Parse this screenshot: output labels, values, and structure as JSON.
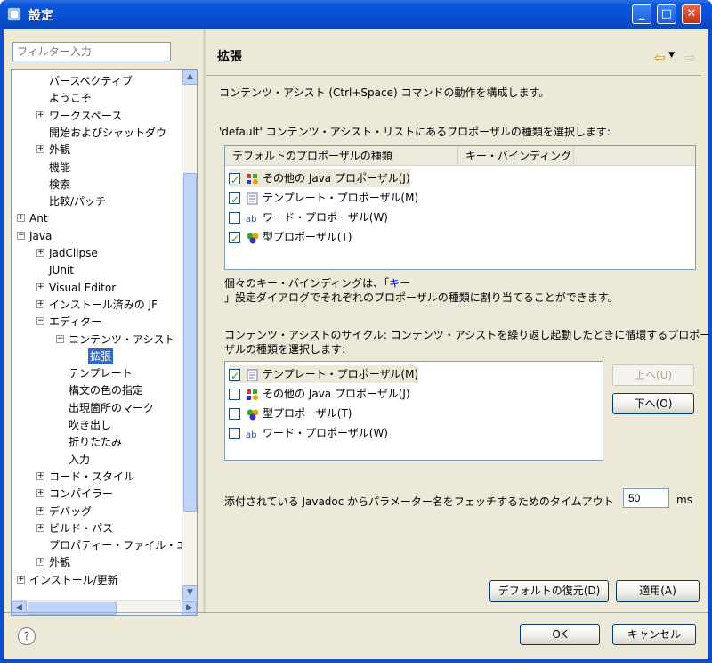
{
  "window": {
    "title": "設定"
  },
  "filter": {
    "placeholder": "フィルター入力"
  },
  "tree": [
    {
      "label": "パースペクティブ",
      "level": 2,
      "expander": ""
    },
    {
      "label": "ようこそ",
      "level": 2,
      "expander": ""
    },
    {
      "label": "ワークスペース",
      "level": 2,
      "expander": "+"
    },
    {
      "label": "開始およびシャットダウ",
      "level": 2,
      "expander": ""
    },
    {
      "label": "外観",
      "level": 2,
      "expander": "+"
    },
    {
      "label": "機能",
      "level": 2,
      "expander": ""
    },
    {
      "label": "検索",
      "level": 2,
      "expander": ""
    },
    {
      "label": "比較/パッチ",
      "level": 2,
      "expander": ""
    },
    {
      "label": "Ant",
      "level": 1,
      "expander": "+"
    },
    {
      "label": "Java",
      "level": 1,
      "expander": "−"
    },
    {
      "label": "JadClipse",
      "level": 2,
      "expander": "+"
    },
    {
      "label": "JUnit",
      "level": 2,
      "expander": ""
    },
    {
      "label": "Visual Editor",
      "level": 2,
      "expander": "+"
    },
    {
      "label": "インストール済みの JF",
      "level": 2,
      "expander": "+"
    },
    {
      "label": "エディター",
      "level": 2,
      "expander": "−"
    },
    {
      "label": "コンテンツ・アシスト",
      "level": 3,
      "expander": "−"
    },
    {
      "label": "拡張",
      "level": 4,
      "expander": "",
      "selected": true
    },
    {
      "label": "テンプレート",
      "level": 3,
      "expander": ""
    },
    {
      "label": "構文の色の指定",
      "level": 3,
      "expander": ""
    },
    {
      "label": "出現箇所のマーク",
      "level": 3,
      "expander": ""
    },
    {
      "label": "吹き出し",
      "level": 3,
      "expander": ""
    },
    {
      "label": "折りたたみ",
      "level": 3,
      "expander": ""
    },
    {
      "label": "入力",
      "level": 3,
      "expander": ""
    },
    {
      "label": "コード・スタイル",
      "level": 2,
      "expander": "+"
    },
    {
      "label": "コンパイラー",
      "level": 2,
      "expander": "+"
    },
    {
      "label": "デバッグ",
      "level": 2,
      "expander": "+"
    },
    {
      "label": "ビルド・パス",
      "level": 2,
      "expander": "+"
    },
    {
      "label": "プロパティー・ファイル・エ",
      "level": 2,
      "expander": ""
    },
    {
      "label": "外観",
      "level": 2,
      "expander": "+"
    },
    {
      "label": "インストール/更新",
      "level": 1,
      "expander": "+"
    }
  ],
  "page": {
    "title": "拡張",
    "intro": "コンテンツ・アシスト (Ctrl+Space) コマンドの動作を構成します。",
    "default_label": "'default' コンテンツ・アシスト・リストにあるプロポーザルの種類を選択します:",
    "col_kind": "デフォルトのプロポーザルの種類",
    "col_key": "キー・バインディング",
    "default_items": [
      {
        "label": "その他の Java プロポーザル(J)",
        "checked": true,
        "icon": "other-java-proposal-icon"
      },
      {
        "label": "テンプレート・プロポーザル(M)",
        "checked": true,
        "icon": "template-proposal-icon"
      },
      {
        "label": "ワード・プロポーザル(W)",
        "checked": false,
        "icon": "word-proposal-icon"
      },
      {
        "label": "型プロポーザル(T)",
        "checked": true,
        "icon": "type-proposal-icon"
      }
    ],
    "keybind_line1": "個々のキー・バインディングは、「",
    "keybind_link": "キー",
    "keybind_line2": "」設定ダイアログでそれぞれのプロポーザルの種類に割り当てることができます。",
    "cycle_line1": "コンテンツ・アシストのサイクル: コンテンツ・アシストを繰り返し起動したときに循環するプロポー",
    "cycle_line2": "ザルの種類を選択します:",
    "cycle_items": [
      {
        "label": "テンプレート・プロポーザル(M)",
        "checked": true,
        "icon": "template-proposal-icon"
      },
      {
        "label": "その他の Java プロポーザル(J)",
        "checked": false,
        "icon": "other-java-proposal-icon"
      },
      {
        "label": "型プロポーザル(T)",
        "checked": false,
        "icon": "type-proposal-icon"
      },
      {
        "label": "ワード・プロポーザル(W)",
        "checked": false,
        "icon": "word-proposal-icon"
      }
    ],
    "up_button": "上へ(U)",
    "down_button": "下へ(O)",
    "timeout_label": "添付されている Javadoc からパラメーター名をフェッチするためのタイムアウト",
    "timeout_value": "50",
    "timeout_unit": "ms",
    "restore_defaults": "デフォルトの復元(D)",
    "apply": "適用(A)"
  },
  "footer": {
    "ok": "OK",
    "cancel": "キャンセル",
    "help": "?"
  }
}
